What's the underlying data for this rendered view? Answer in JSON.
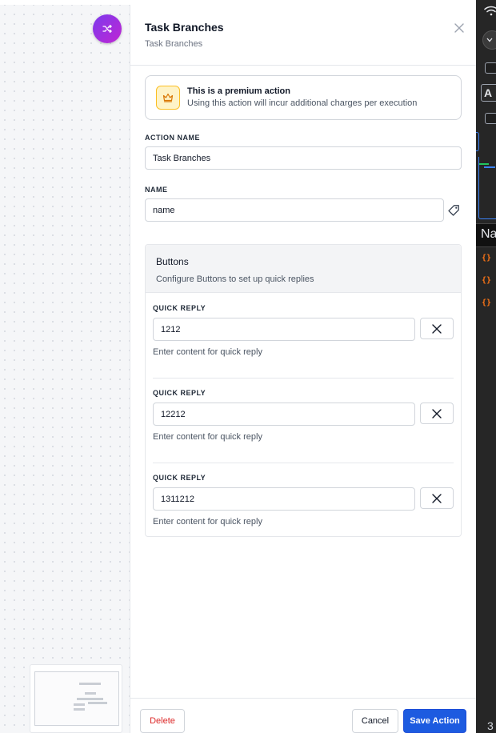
{
  "panel": {
    "title": "Task Branches",
    "subtitle": "Task Branches"
  },
  "premium": {
    "title": "This is a premium action",
    "description": "Using this action will incur additional charges per execution"
  },
  "fields": {
    "action_name_label": "ACTION NAME",
    "action_name_value": "Task Branches",
    "name_label": "NAME",
    "name_value": "name"
  },
  "buttons_section": {
    "title": "Buttons",
    "description": "Configure Buttons to set up quick replies",
    "quick_replies": [
      {
        "label": "QUICK REPLY",
        "value": "1212",
        "help": "Enter content for quick reply"
      },
      {
        "label": "QUICK REPLY",
        "value": "12212",
        "help": "Enter content for quick reply"
      },
      {
        "label": "QUICK REPLY",
        "value": "1311212",
        "help": "Enter content for quick reply"
      }
    ]
  },
  "footer": {
    "delete_label": "Delete",
    "cancel_label": "Cancel",
    "save_label": "Save Action"
  },
  "right_sidebar": {
    "letter_a": "A",
    "col_header": "Na",
    "bottom_number": "3"
  },
  "colors": {
    "accent_blue": "#1d5be0",
    "danger_red": "#dc2626",
    "premium_bg": "#fef3c7",
    "premium_border": "#fbbf24",
    "avatar_gradient_start": "#7c3aed",
    "avatar_gradient_end": "#c026d3",
    "dark_sidebar": "#262626",
    "curly_orange": "#f97316"
  },
  "icons": {
    "avatar": "shuffle-icon",
    "close": "close-icon",
    "premium": "crown-icon",
    "tag": "tag-icon",
    "remove": "x-icon",
    "wifi": "wifi-icon",
    "variable": "curly-braces-icon"
  }
}
